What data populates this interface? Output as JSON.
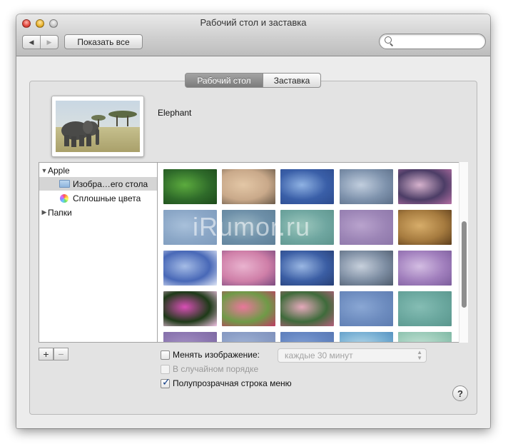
{
  "window": {
    "title": "Рабочий стол и заставка",
    "nav_back": "◀",
    "nav_forward": "▶",
    "show_all": "Показать все",
    "search_placeholder": ""
  },
  "tabs": [
    {
      "label": "Рабочий стол",
      "selected": true
    },
    {
      "label": "Заставка",
      "selected": false
    }
  ],
  "current_image": {
    "name": "Elephant"
  },
  "sources": {
    "group_apple": "Apple",
    "item_desktop_pictures": "Изобра…его стола",
    "item_solid_colors": "Сплошные цвета",
    "group_folders": "Папки"
  },
  "thumbnails": [
    {
      "name": "green-grass",
      "colors": [
        "#2f6b2a",
        "#5cab3e",
        "#1d4a1b"
      ]
    },
    {
      "name": "island-lake",
      "colors": [
        "#c9a98a",
        "#e3c7a6",
        "#6a5a49"
      ]
    },
    {
      "name": "blue-wave-1",
      "colors": [
        "#3a5fa8",
        "#8fb2e3",
        "#2c4b8e"
      ]
    },
    {
      "name": "blue-gray-wave",
      "colors": [
        "#7f93ad",
        "#c1cede",
        "#5a6d87"
      ]
    },
    {
      "name": "mountain-lake-dusk",
      "colors": [
        "#4c3d66",
        "#d6b2cd",
        "#b46fa4"
      ]
    },
    {
      "name": "steel-blue",
      "colors": [
        "#8ba7c7",
        "#a8c0da",
        "#7f9cbd"
      ]
    },
    {
      "name": "blue-teal",
      "colors": [
        "#6d8fa8",
        "#9bb7c4",
        "#5f8098"
      ]
    },
    {
      "name": "teal-green",
      "colors": [
        "#6fa6a0",
        "#9cc7bd",
        "#5d948d"
      ]
    },
    {
      "name": "purple-violet",
      "colors": [
        "#9c85b6",
        "#b9a3cd",
        "#8c76a8"
      ]
    },
    {
      "name": "lion",
      "colors": [
        "#a67b3f",
        "#d7ad6a",
        "#5d3e1c"
      ]
    },
    {
      "name": "sky-moon",
      "colors": [
        "#4868b7",
        "#a5bce6",
        "#dfe6f6"
      ]
    },
    {
      "name": "pink-mountain",
      "colors": [
        "#cf7fa8",
        "#e9b3cf",
        "#7c4b7f"
      ]
    },
    {
      "name": "blue-wave-2",
      "colors": [
        "#3b5ea4",
        "#9ab7e3",
        "#273f75"
      ]
    },
    {
      "name": "gray-wave",
      "colors": [
        "#7d8da2",
        "#c7d0dc",
        "#4e5b6c"
      ]
    },
    {
      "name": "lavender-field",
      "colors": [
        "#a17fbd",
        "#d3bde2",
        "#7c5d9c"
      ]
    },
    {
      "name": "lotus-flower",
      "colors": [
        "#1e3a18",
        "#d94fb6",
        "#f3c4e6"
      ]
    },
    {
      "name": "poppies",
      "colors": [
        "#6f9a47",
        "#e9779b",
        "#c03b64"
      ]
    },
    {
      "name": "pink-blossoms",
      "colors": [
        "#3f6b3b",
        "#e5a9bb",
        "#b55f7c"
      ]
    },
    {
      "name": "slate-blue",
      "colors": [
        "#6d8cbf",
        "#8aa7d4",
        "#5d7cb0"
      ]
    },
    {
      "name": "sea-green",
      "colors": [
        "#6aa79e",
        "#85bdb4",
        "#5a968d"
      ]
    },
    {
      "name": "violet-2",
      "colors": [
        "#8c77b1",
        "#a894c6",
        "#7b67a0"
      ]
    },
    {
      "name": "periwinkle",
      "colors": [
        "#8b9ec6",
        "#a6b7d8",
        "#7d8fba"
      ]
    },
    {
      "name": "blue-3",
      "colors": [
        "#6586c2",
        "#86a3d6",
        "#5675b1"
      ]
    },
    {
      "name": "blue-mosaic",
      "colors": [
        "#7ab1d4",
        "#bcdcec",
        "#4f8cbd"
      ]
    },
    {
      "name": "green-mosaic",
      "colors": [
        "#9ccbb9",
        "#c7e5d8",
        "#79b4a0"
      ]
    }
  ],
  "watermark": "iRumor.ru",
  "add_remove": {
    "add": "+",
    "remove": "−"
  },
  "options": {
    "change_picture": {
      "label": "Менять изображение:",
      "checked": false
    },
    "interval": {
      "value": "каждые 30 минут"
    },
    "random_order": {
      "label": "В случайном порядке",
      "checked": false,
      "enabled": false
    },
    "translucent_menu_bar": {
      "label": "Полупрозрачная строка меню",
      "checked": true
    }
  },
  "help": "?",
  "colors": {
    "tab_selected": "#8c8c8c",
    "source_selected": "#d5d5d5",
    "checkbox_mark": "#123e86"
  }
}
